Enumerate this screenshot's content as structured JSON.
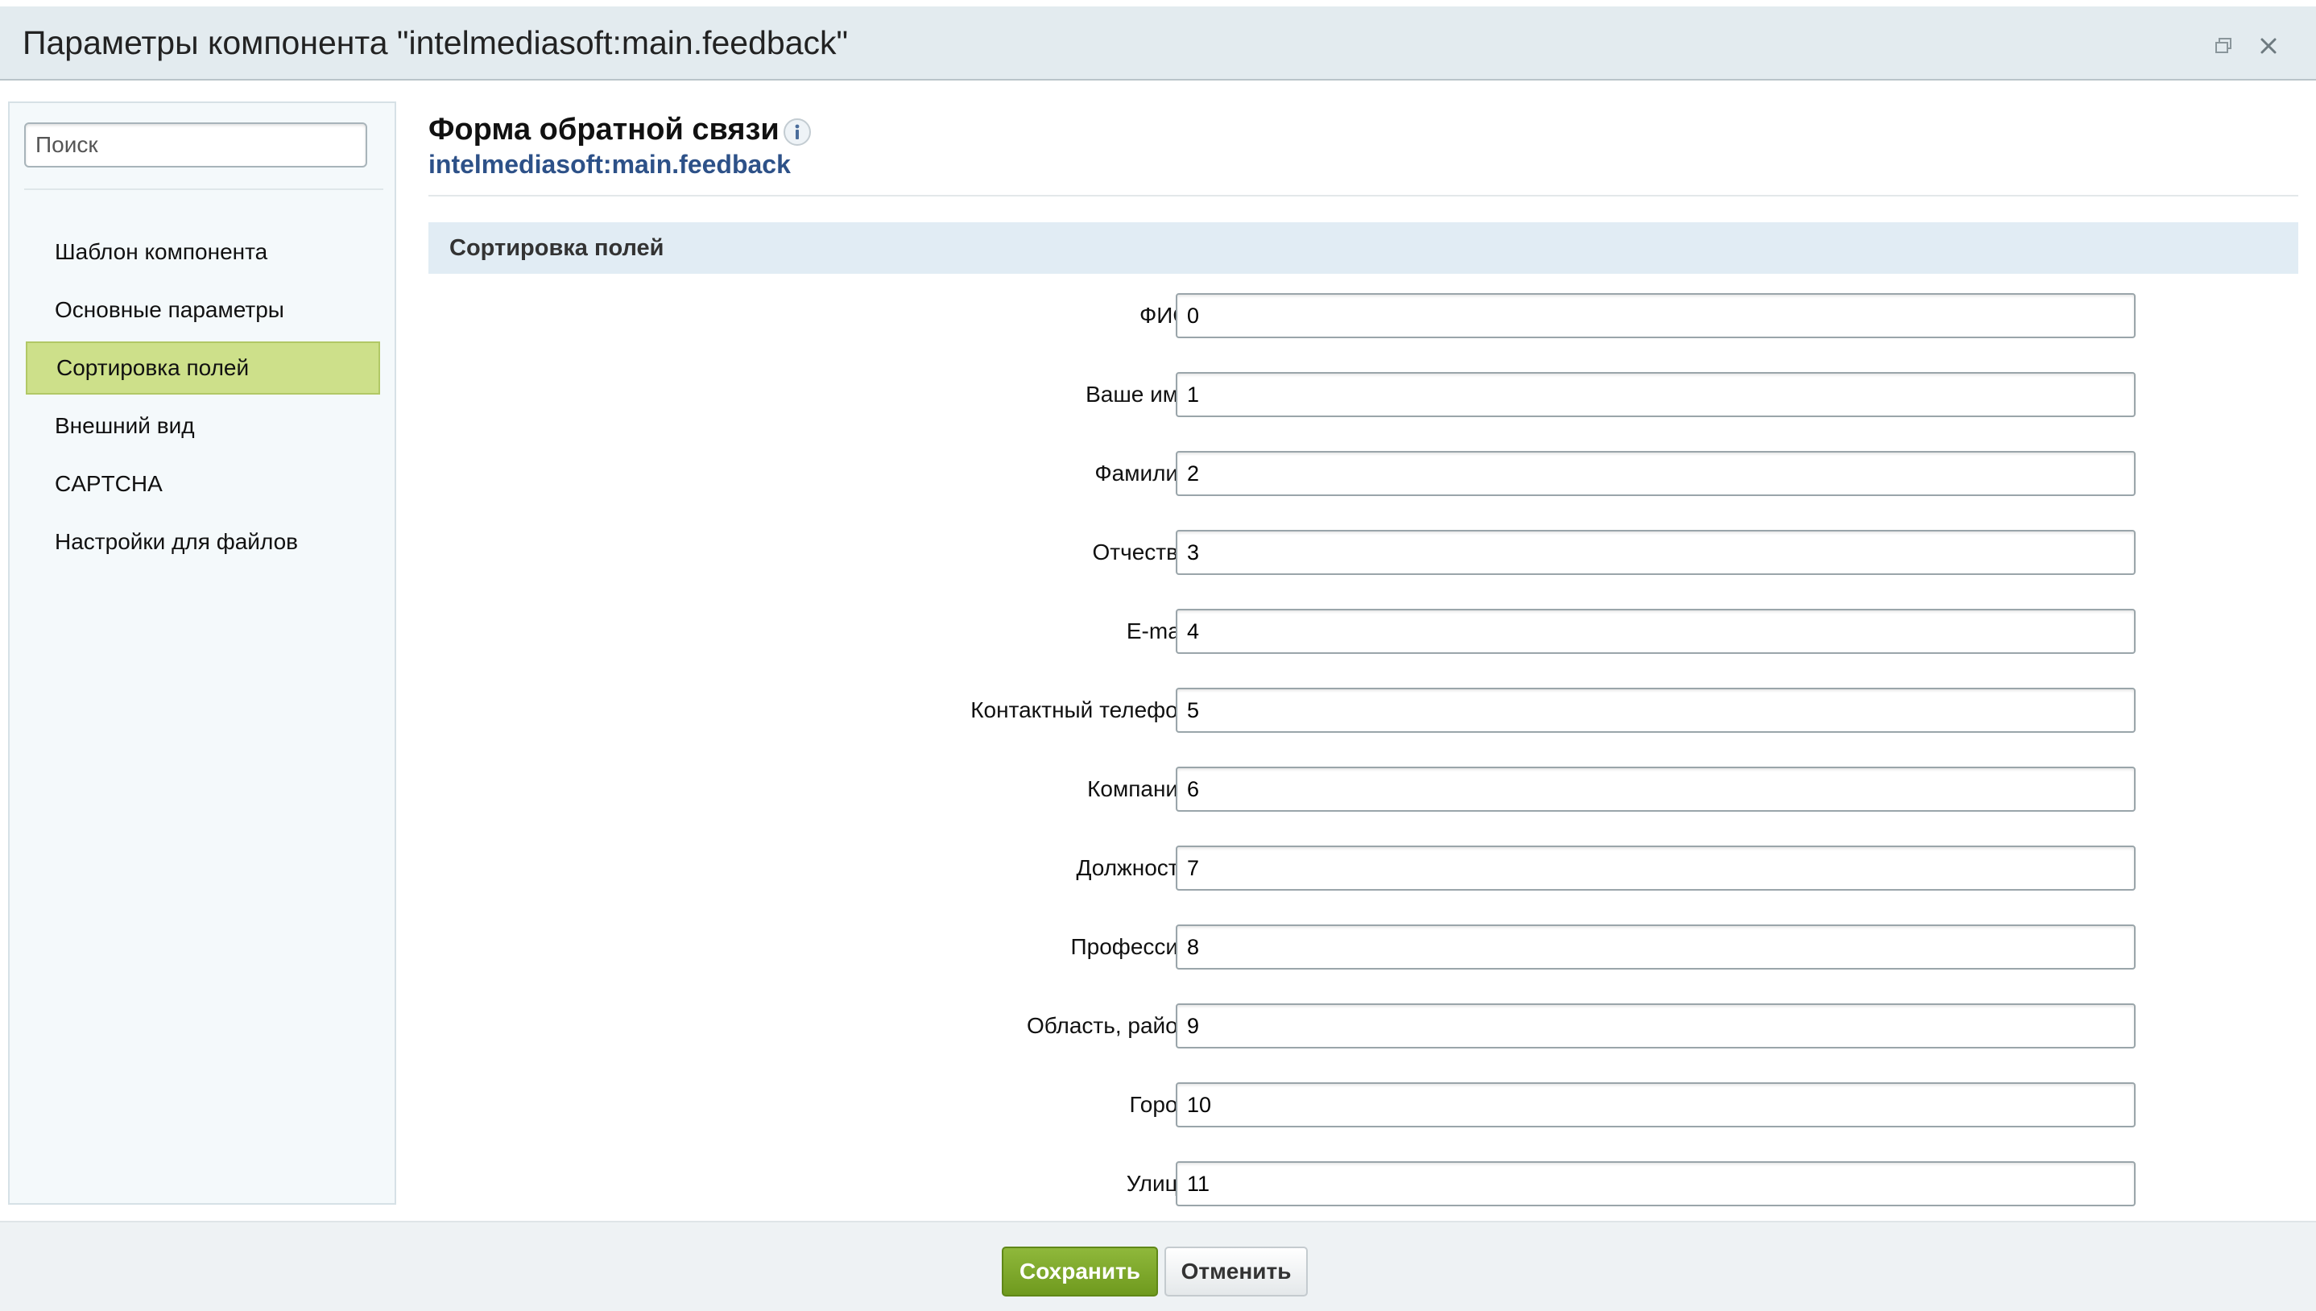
{
  "window": {
    "title": "Параметры компонента \"intelmediasoft:main.feedback\""
  },
  "sidebar": {
    "search_placeholder": "Поиск",
    "items": [
      {
        "label": "Шаблон компонента"
      },
      {
        "label": "Основные параметры"
      },
      {
        "label": "Сортировка полей",
        "active": true
      },
      {
        "label": "Внешний вид"
      },
      {
        "label": "CAPTCHA"
      },
      {
        "label": "Настройки для файлов"
      }
    ]
  },
  "component": {
    "title": "Форма обратной связи",
    "code": "intelmediasoft:main.feedback"
  },
  "section": {
    "title": "Сортировка полей",
    "fields": [
      {
        "label": "ФИО:",
        "value": "0"
      },
      {
        "label": "Ваше имя:",
        "value": "1"
      },
      {
        "label": "Фамилия:",
        "value": "2"
      },
      {
        "label": "Отчество:",
        "value": "3"
      },
      {
        "label": "E-mail:",
        "value": "4"
      },
      {
        "label": "Контактный телефон:",
        "value": "5"
      },
      {
        "label": "Компания:",
        "value": "6"
      },
      {
        "label": "Должность:",
        "value": "7"
      },
      {
        "label": "Профессия:",
        "value": "8"
      },
      {
        "label": "Область, район:",
        "value": "9"
      },
      {
        "label": "Город:",
        "value": "10"
      },
      {
        "label": "Улица:",
        "value": "11"
      }
    ]
  },
  "footer": {
    "save_label": "Сохранить",
    "cancel_label": "Отменить"
  },
  "colors": {
    "active_nav": "#cde08a",
    "link": "#2d5188",
    "save_button": "#7aa52a"
  }
}
